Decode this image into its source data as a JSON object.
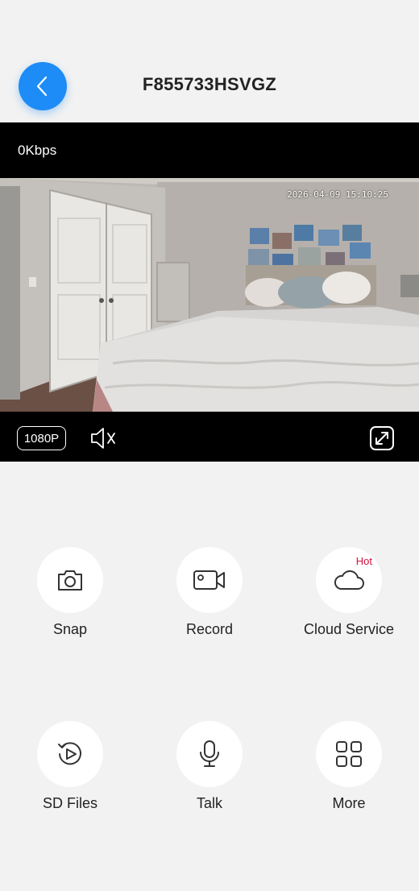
{
  "header": {
    "title": "F855733HSVGZ",
    "back_icon": "chevron-left-icon"
  },
  "player": {
    "bitrate": "0Kbps",
    "timestamp": "2026-04-09 15:10:25",
    "resolution_label": "1080P",
    "mute_icon": "speaker-muted-icon",
    "fullscreen_icon": "fullscreen-icon"
  },
  "actions": [
    {
      "label": "Snap",
      "icon": "camera-icon"
    },
    {
      "label": "Record",
      "icon": "video-camera-icon"
    },
    {
      "label": "Cloud Service",
      "icon": "cloud-icon",
      "badge": "Hot"
    },
    {
      "label": "SD Files",
      "icon": "replay-icon"
    },
    {
      "label": "Talk",
      "icon": "microphone-icon"
    },
    {
      "label": "More",
      "icon": "grid-icon"
    }
  ],
  "colors": {
    "accent": "#1e8cf7",
    "hot_badge": "#d6113f",
    "background": "#f2f2f2"
  }
}
